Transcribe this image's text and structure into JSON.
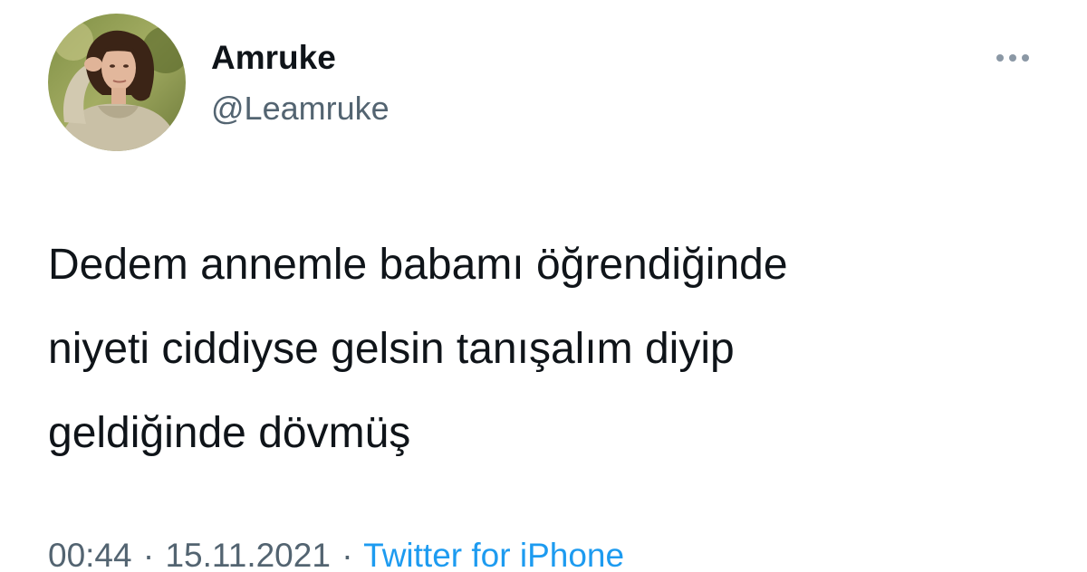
{
  "tweet": {
    "author": {
      "display_name": "Amruke",
      "handle": "@Leamruke"
    },
    "more_icon": "more-horizontal-icon",
    "text_lines": [
      "Dedem annemle babamı öğrendiğinde",
      "niyeti ciddiyse gelsin tanışalım diyip",
      "geldiğinde dövmüş"
    ],
    "time": "00:44",
    "separator": "·",
    "date": "15.11.2021",
    "source": "Twitter for iPhone"
  },
  "colors": {
    "text": "#0f1419",
    "secondary": "#536471",
    "link": "#1d9bf0"
  }
}
